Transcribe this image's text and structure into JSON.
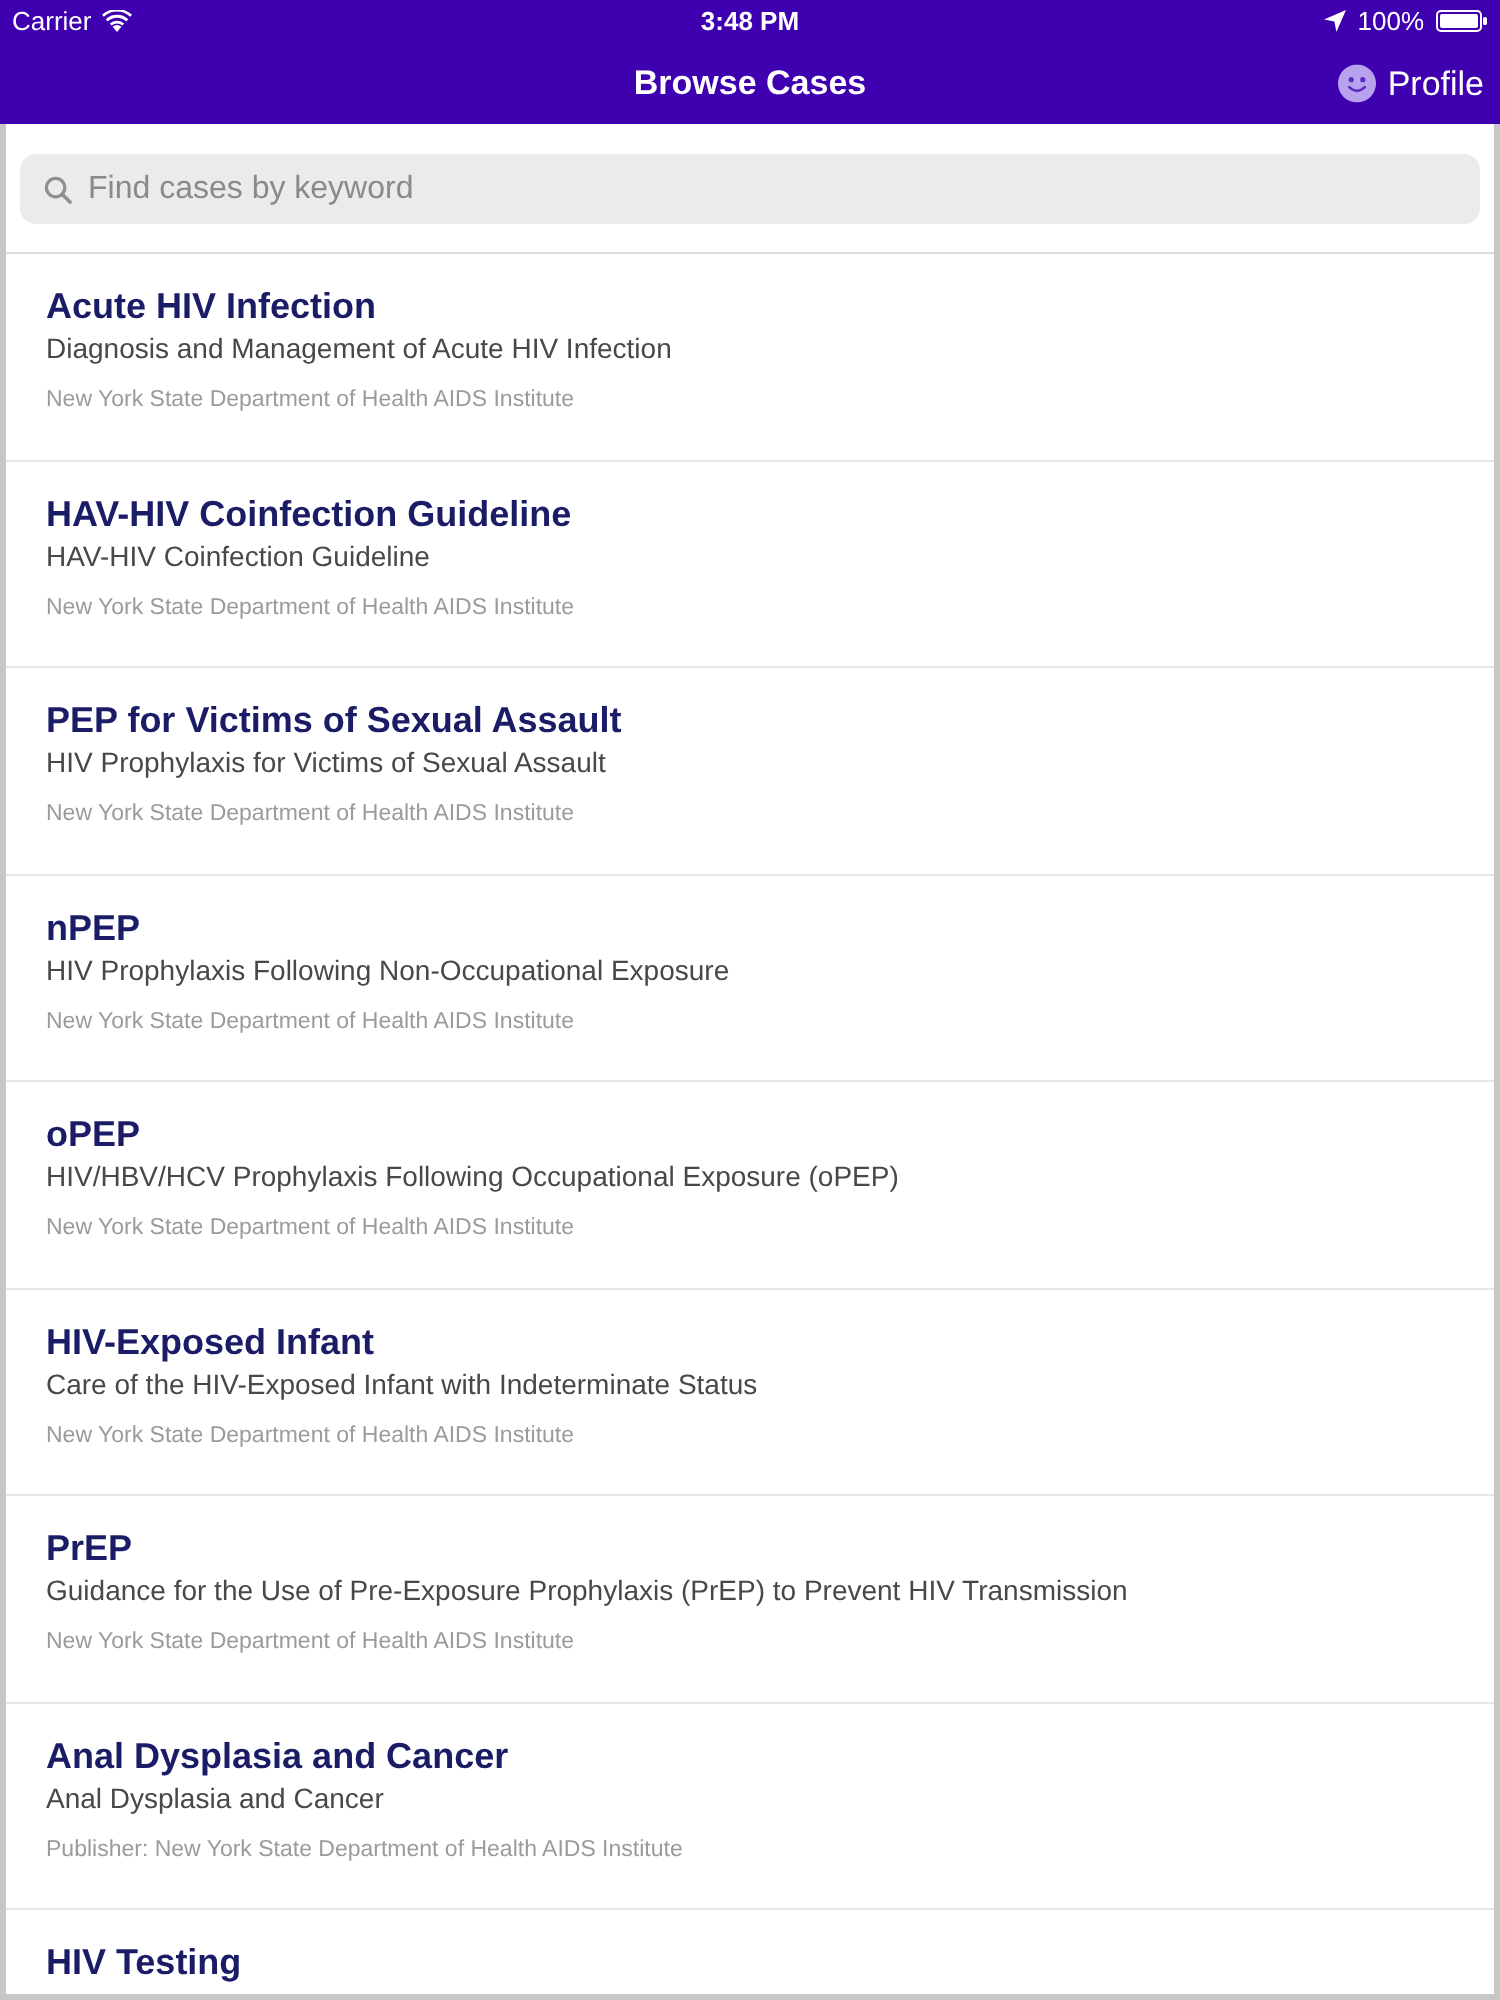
{
  "status_bar": {
    "carrier": "Carrier",
    "time": "3:48 PM",
    "battery": "100%"
  },
  "nav_bar": {
    "title": "Browse Cases",
    "profile_button": "Profile"
  },
  "search": {
    "placeholder": "Find cases by keyword"
  },
  "cases": [
    {
      "title": "Acute HIV Infection",
      "subtitle": "Diagnosis and Management of Acute HIV Infection",
      "publisher": "New York State Department of Health AIDS Institute"
    },
    {
      "title": "HAV-HIV Coinfection Guideline",
      "subtitle": "HAV-HIV Coinfection Guideline",
      "publisher": "New York State Department of Health AIDS Institute"
    },
    {
      "title": "PEP for Victims of Sexual Assault",
      "subtitle": "HIV Prophylaxis for Victims of Sexual Assault",
      "publisher": "New York State Department of Health AIDS Institute"
    },
    {
      "title": "nPEP",
      "subtitle": "HIV Prophylaxis Following Non-Occupational Exposure",
      "publisher": "New York State Department of Health AIDS Institute"
    },
    {
      "title": "oPEP",
      "subtitle": "HIV/HBV/HCV Prophylaxis Following Occupational Exposure (oPEP)",
      "publisher": "New York State Department of Health AIDS Institute"
    },
    {
      "title": "HIV-Exposed Infant",
      "subtitle": "Care of the HIV-Exposed Infant with Indeterminate Status",
      "publisher": "New York State Department of Health AIDS Institute"
    },
    {
      "title": "PrEP",
      "subtitle": "Guidance for the Use of Pre-Exposure Prophylaxis (PrEP) to Prevent HIV Transmission",
      "publisher": "New York State Department of Health AIDS Institute"
    },
    {
      "title": "Anal Dysplasia and Cancer",
      "subtitle": "Anal Dysplasia and Cancer",
      "publisher": "Publisher: New York State Department of Health AIDS Institute"
    },
    {
      "title": "HIV Testing"
    }
  ]
}
